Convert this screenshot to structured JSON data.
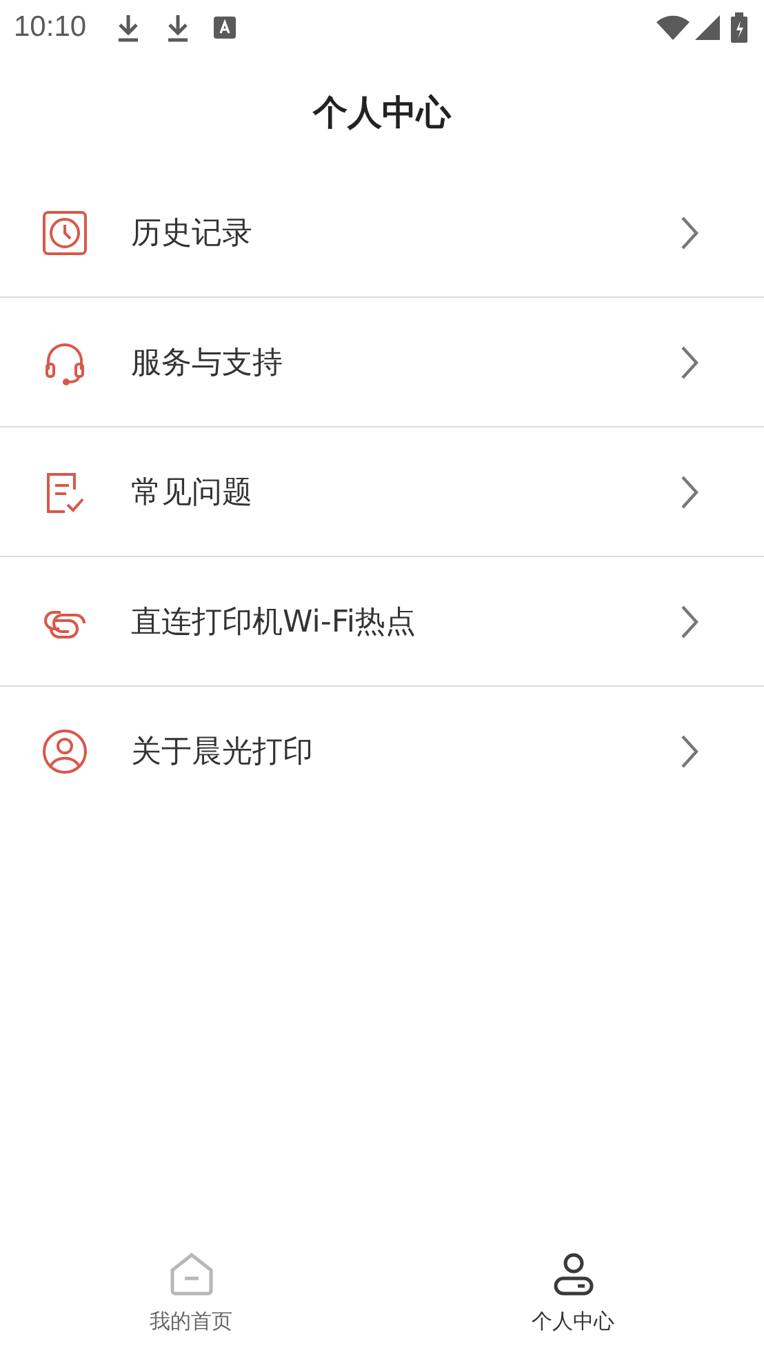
{
  "status_bar": {
    "time": "10:10"
  },
  "header": {
    "title": "个人中心"
  },
  "menu": [
    {
      "kind": "clock",
      "label": "历史记录"
    },
    {
      "kind": "headset",
      "label": "服务与支持"
    },
    {
      "kind": "note",
      "label": "常见问题"
    },
    {
      "kind": "link",
      "label": "直连打印机Wi-Fi热点"
    },
    {
      "kind": "person",
      "label": "关于晨光打印"
    }
  ],
  "tabs": [
    {
      "kind": "home",
      "label": "我的首页",
      "selected": false
    },
    {
      "kind": "person",
      "label": "个人中心",
      "selected": true
    }
  ]
}
